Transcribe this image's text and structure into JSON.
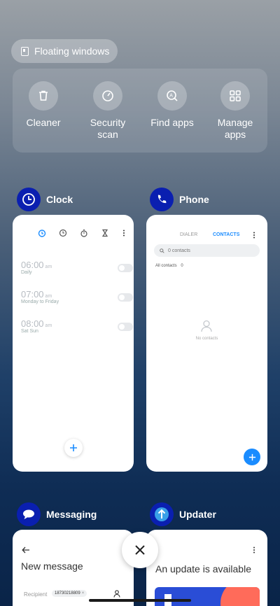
{
  "floating_windows": {
    "label": "Floating windows"
  },
  "tools": [
    {
      "label": "Cleaner",
      "icon": "trash-icon"
    },
    {
      "label": "Security scan",
      "icon": "shield-gauge-icon"
    },
    {
      "label": "Find apps",
      "icon": "find-apps-icon"
    },
    {
      "label": "Manage apps",
      "icon": "grid-icon"
    }
  ],
  "clock": {
    "title": "Clock",
    "alarms": [
      {
        "time": "06:00",
        "ampm": "am",
        "repeat": "Daily"
      },
      {
        "time": "07:00",
        "ampm": "am",
        "repeat": "Monday to Friday"
      },
      {
        "time": "08:00",
        "ampm": "am",
        "repeat": "Sat Sun"
      }
    ]
  },
  "phone": {
    "title": "Phone",
    "tabs": {
      "dialer": "DIALER",
      "contacts": "CONTACTS"
    },
    "search_placeholder": "0 contacts",
    "all_contacts_label": "All contacts",
    "all_contacts_count": "0",
    "empty_label": "No contacts"
  },
  "messaging": {
    "title": "Messaging",
    "heading": "New message",
    "recipient_label": "Recipient",
    "recipient_value": "18730218809"
  },
  "updater": {
    "title": "Updater",
    "heading": "An update is available"
  },
  "colors": {
    "accent_blue": "#1a8cff",
    "app_icon_blue": "#0a1fb0"
  }
}
